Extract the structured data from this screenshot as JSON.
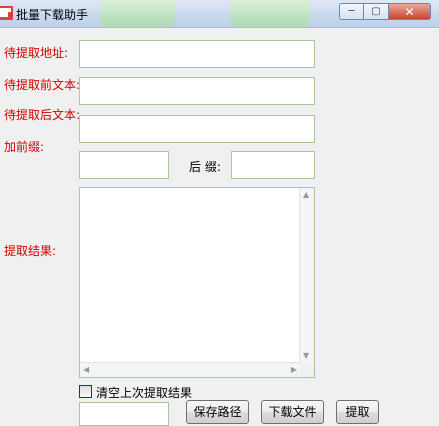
{
  "window": {
    "title": "批量下载助手",
    "controls": {
      "minimize": "─",
      "maximize": "▢",
      "close": "✕"
    }
  },
  "form": {
    "url_label": "待提取地址:",
    "url_value": "",
    "before_label": "待提取前文本:",
    "before_value": "",
    "after_label": "待提取后文本:",
    "after_value": "",
    "prefix_label": "加前缀:",
    "prefix_value": "",
    "suffix_label": "后 缀:",
    "suffix_value": "",
    "result_label": "提取结果:",
    "result_value": ""
  },
  "options": {
    "clear_last_label": "清空上次提取结果",
    "clear_last_checked": false
  },
  "bottom": {
    "path_value": "",
    "save_path_label": "保存路径",
    "download_file_label": "下载文件",
    "extract_label": "提取"
  },
  "colors": {
    "label_red": "#d40000",
    "field_border": "#a9c99a",
    "titlebar": "#c9daee"
  }
}
